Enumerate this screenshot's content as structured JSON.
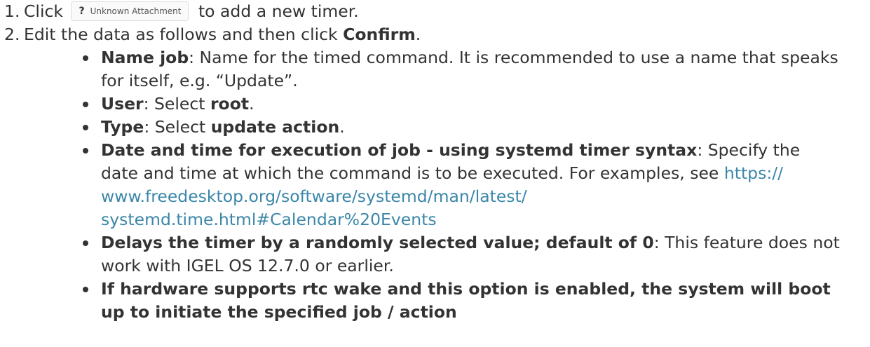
{
  "steps": [
    {
      "number": "1.",
      "before": "Click",
      "attachment": {
        "icon": "?",
        "label": "Unknown Attachment"
      },
      "after": "to add a new timer."
    },
    {
      "number": "2.",
      "before": "Edit the data as follows and then click ",
      "strong": "Confirm",
      "after": "."
    }
  ],
  "params": [
    {
      "term": "Name job",
      "text": ": Name for the timed command. It is recommended to use a name that speaks for itself, e.g. “Update”."
    },
    {
      "term": "User",
      "text": ": Select ",
      "value": "root",
      "end": "."
    },
    {
      "term": "Type",
      "text": ": Select ",
      "value": "update action",
      "end": "."
    },
    {
      "term": "Date and time for execution of job - using systemd timer syntax",
      "text": ": Specify the date and time at which the command is to be executed. For examples, see ",
      "link_lines": [
        "https://",
        "www.freedesktop.org/software/systemd/man/latest/",
        "systemd.time.html#Calendar%20Events"
      ]
    },
    {
      "term": "Delays the timer by a randomly selected value; default of 0",
      "text": ": This feature does not work with IGEL OS 12.7.0 or earlier."
    },
    {
      "term": "If hardware supports rtc wake and this option is enabled, the system will boot up to initiate the specified job / action"
    }
  ],
  "colors": {
    "text": "#333333",
    "link": "#3b87a8",
    "attachment_border": "#dcdcdc"
  }
}
